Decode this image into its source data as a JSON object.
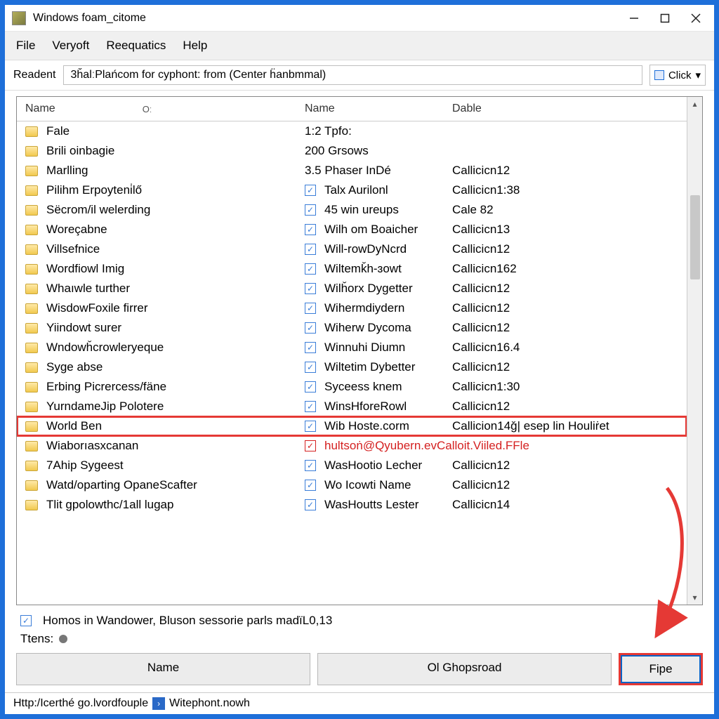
{
  "window": {
    "title": "Windows foam_citome"
  },
  "menu": {
    "items": [
      "File",
      "Veryoft",
      "Reequatics",
      "Help"
    ]
  },
  "toolbar": {
    "label": "Readent",
    "path": "3ȟalːPlańcom for cyphont: from (Center ḧanbmmal)",
    "click_label": "Click"
  },
  "columns": {
    "col1": "Name",
    "col1_sub": "Oː",
    "col2": "Name",
    "col3": "Dable"
  },
  "rows": [
    {
      "folder": "Fale",
      "checked": false,
      "name": "1:2 Tpfo:",
      "dable": ""
    },
    {
      "folder": "Brili oinbagie",
      "checked": false,
      "name": "200 Grsows",
      "dable": ""
    },
    {
      "folder": "Marlling",
      "checked": false,
      "name": "3.5 Phaser InDé",
      "dable": "Callicicn12"
    },
    {
      "folder": "Pilihm Erpoyteni̇lő",
      "checked": true,
      "name": "Talx Aurilonl",
      "dable": "Callicicn1:38"
    },
    {
      "folder": "Sëcrom/il welerding",
      "checked": true,
      "name": "45 win ureups",
      "dable": "Cale 82"
    },
    {
      "folder": "Woreçabne",
      "checked": true,
      "name": "Wilh om Boaicher",
      "dable": "Callicicn13"
    },
    {
      "folder": "Villsefnice",
      "checked": true,
      "name": "Will-rowDyNcrd",
      "dable": "Callicicn12"
    },
    {
      "folder": "Wordfiowl Imig",
      "checked": true,
      "name": "Wiltemǩh-ɜowt",
      "dable": "Callicicn162"
    },
    {
      "folder": "Whaıwle turther",
      "checked": true,
      "name": "Wilȟorx Dygetter",
      "dable": "Callicicn12"
    },
    {
      "folder": "WisdowFoxile firrer",
      "checked": true,
      "name": "Wihermdiydern",
      "dable": "Callicicn12"
    },
    {
      "folder": "Yiindowt surer",
      "checked": true,
      "name": "Wiherw Dycoma",
      "dable": "Callicicn12"
    },
    {
      "folder": "Wndowȟcrowleryeque",
      "checked": true,
      "name": "Winnuhi Diumn",
      "dable": "Callicicn16.4"
    },
    {
      "folder": "Syge abse",
      "checked": true,
      "name": "Wiltetim Dybetter",
      "dable": "Callicicn12"
    },
    {
      "folder": "Erbing Picrercess/fäne",
      "checked": true,
      "name": "Syceess knem",
      "dable": "Callicicn1:30"
    },
    {
      "folder": "YurndameJip Polotere",
      "checked": true,
      "name": "WinsHforeRowl",
      "dable": "Callicicn12"
    },
    {
      "folder": "World Ben",
      "checked": true,
      "name": "Wib Hoste.corm",
      "dable": "Callicion14ǧ| esep lin Houliṙet",
      "highlight": true
    },
    {
      "folder": "Wiaborıasxcanan",
      "checked": true,
      "name": "hultsoṅ@Qyubern.evCalloit.Viiled.FFle",
      "dable": "",
      "alert": true
    },
    {
      "folder": "7Ahip Sygeest",
      "checked": true,
      "name": "WasHootio Lecher",
      "dable": "Callicicn12"
    },
    {
      "folder": "Watd/oparting OpaneScafter",
      "checked": true,
      "name": "Wo Icowti Name",
      "dable": "Callicicn12"
    },
    {
      "folder": "Tlit gpolowthc/1all lugap",
      "checked": true,
      "name": "WasHoutts Lester",
      "dable": "Callicicn14"
    }
  ],
  "option": {
    "checked": true,
    "label": "Homos in Wandower, Bluson sessorie parls madïL0,13"
  },
  "status_label": "Ttens:",
  "buttons": {
    "name": "Name",
    "ghopsroad": "Ol Ghopsroad",
    "fipe": "Fipe"
  },
  "statusbar": {
    "url": "Http:/Icerthé go.lvordfouple",
    "crumb2": "Witephont.nowh"
  }
}
